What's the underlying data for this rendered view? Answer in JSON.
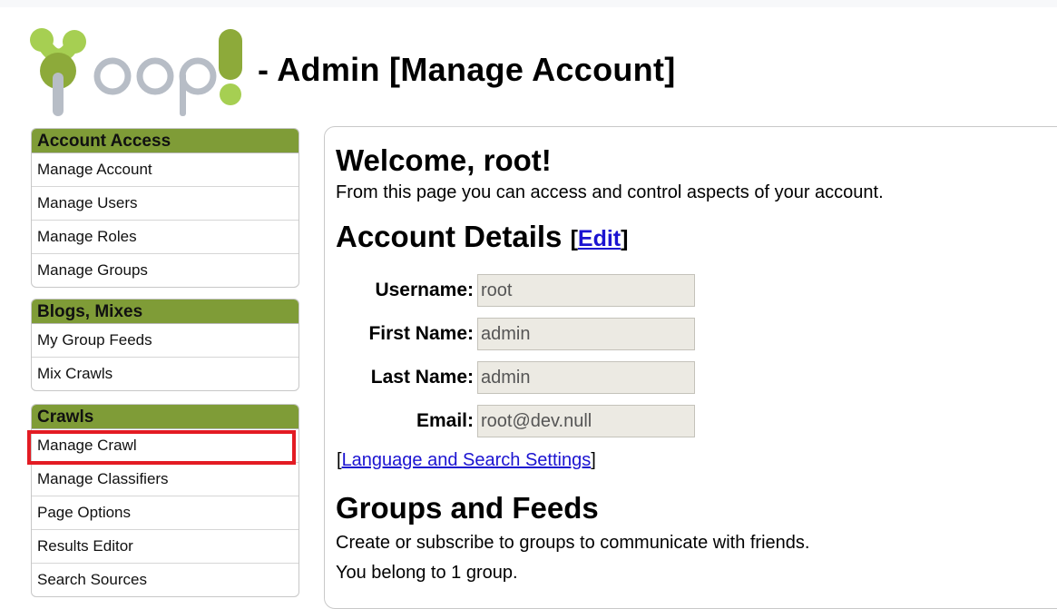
{
  "header": {
    "title": "- Admin [Manage Account]"
  },
  "sidebar": {
    "groups": [
      {
        "title": "Account Access",
        "items": [
          "Manage Account",
          "Manage Users",
          "Manage Roles",
          "Manage Groups"
        ]
      },
      {
        "title": "Blogs, Mixes",
        "items": [
          "My Group Feeds",
          "Mix Crawls"
        ]
      },
      {
        "title": "Crawls",
        "items": [
          "Manage Crawl",
          "Manage Classifiers",
          "Page Options",
          "Results Editor",
          "Search Sources"
        ]
      }
    ],
    "highlighted_item": "Manage Crawl"
  },
  "main": {
    "welcome": "Welcome, root!",
    "intro": "From this page you can access and control aspects of your account.",
    "account_details": {
      "heading": "Account Details",
      "edit_label": "Edit",
      "fields": [
        {
          "label": "Username:",
          "value": "root"
        },
        {
          "label": "First Name:",
          "value": "admin"
        },
        {
          "label": "Last Name:",
          "value": "admin"
        },
        {
          "label": "Email:",
          "value": "root@dev.null"
        }
      ]
    },
    "language_link": "Language and Search Settings",
    "groups_feeds": {
      "heading": "Groups and Feeds",
      "line1": "Create or subscribe to groups to communicate with friends.",
      "line2": "You belong to 1 group."
    }
  },
  "colors": {
    "brand_green": "#7f9c37",
    "logo_light_green": "#a6cf52",
    "logo_gray": "#b7bdc6",
    "highlight_red": "#e31b23",
    "link_blue": "#1b13d1"
  }
}
